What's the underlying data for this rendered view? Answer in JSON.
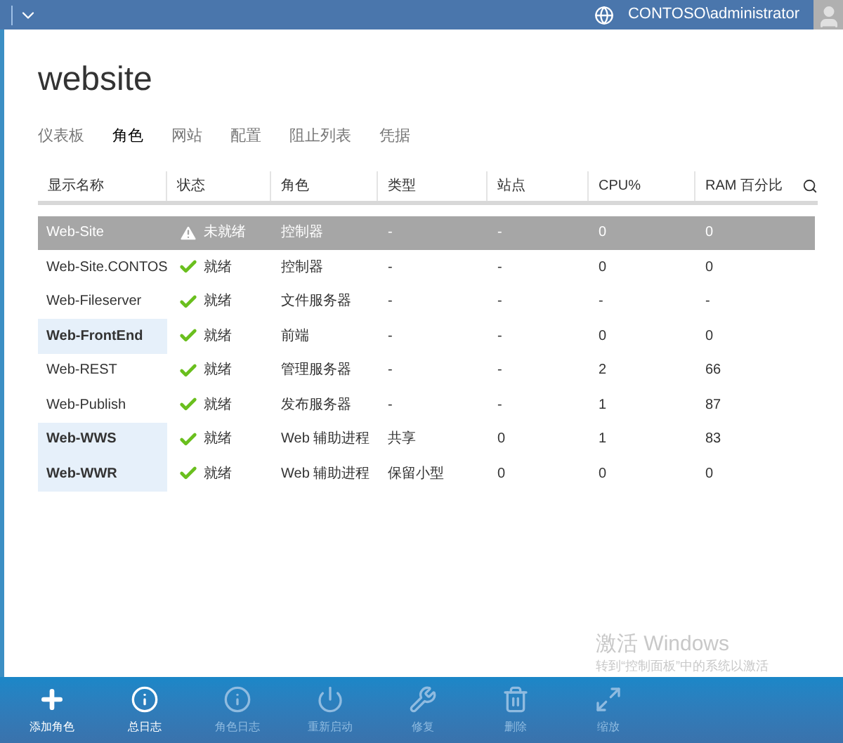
{
  "top_bar": {
    "user": "CONTOSO\\administrator"
  },
  "page_title": "website",
  "tabs": [
    {
      "label": "仪表板",
      "selected": false
    },
    {
      "label": "角色",
      "selected": true
    },
    {
      "label": "网站",
      "selected": false
    },
    {
      "label": "配置",
      "selected": false
    },
    {
      "label": "阻止列表",
      "selected": false
    },
    {
      "label": "凭据",
      "selected": false
    }
  ],
  "table": {
    "columns": [
      "显示名称",
      "状态",
      "角色",
      "类型",
      "站点",
      "CPU%",
      "RAM 百分比"
    ],
    "rows": [
      {
        "name": "Web-Site",
        "marked": false,
        "selected": true,
        "kind": "warning",
        "status": "未就绪",
        "role": "控制器",
        "type": "-",
        "sites": "-",
        "cpu": "0",
        "ram": "0"
      },
      {
        "name": "Web-Site.CONTOS",
        "marked": false,
        "selected": false,
        "kind": "ready",
        "status": "就绪",
        "role": "控制器",
        "type": "-",
        "sites": "-",
        "cpu": "0",
        "ram": "0"
      },
      {
        "name": "Web-Fileserver",
        "marked": false,
        "selected": false,
        "kind": "ready",
        "status": "就绪",
        "role": "文件服务器",
        "type": "-",
        "sites": "-",
        "cpu": "-",
        "ram": "-"
      },
      {
        "name": "Web-FrontEnd",
        "marked": true,
        "selected": false,
        "kind": "ready",
        "status": "就绪",
        "role": "前端",
        "type": "-",
        "sites": "-",
        "cpu": "0",
        "ram": "0"
      },
      {
        "name": "Web-REST",
        "marked": false,
        "selected": false,
        "kind": "ready",
        "status": "就绪",
        "role": "管理服务器",
        "type": "-",
        "sites": "-",
        "cpu": "2",
        "ram": "66"
      },
      {
        "name": "Web-Publish",
        "marked": false,
        "selected": false,
        "kind": "ready",
        "status": "就绪",
        "role": "发布服务器",
        "type": "-",
        "sites": "-",
        "cpu": "1",
        "ram": "87"
      },
      {
        "name": "Web-WWS",
        "marked": true,
        "selected": false,
        "kind": "ready",
        "status": "就绪",
        "role": "Web 辅助进程",
        "type": "共享",
        "sites": "0",
        "cpu": "1",
        "ram": "83"
      },
      {
        "name": "Web-WWR",
        "marked": true,
        "selected": false,
        "kind": "ready",
        "status": "就绪",
        "role": "Web 辅助进程",
        "type": "保留小型",
        "sites": "0",
        "cpu": "0",
        "ram": "0"
      }
    ]
  },
  "activation_notice": {
    "title": "激活 Windows",
    "text": "转到“控制面板”中的系统以激活"
  },
  "command_bar": [
    {
      "kind": "add",
      "label": "添加角色",
      "disabled": false
    },
    {
      "kind": "info",
      "label": "总日志",
      "disabled": false
    },
    {
      "kind": "info",
      "label": "角色日志",
      "disabled": true
    },
    {
      "kind": "power",
      "label": "重新启动",
      "disabled": true
    },
    {
      "kind": "repair",
      "label": "修复",
      "disabled": true
    },
    {
      "kind": "delete",
      "label": "删除",
      "disabled": true
    },
    {
      "kind": "scale",
      "label": "缩放",
      "disabled": true
    }
  ]
}
